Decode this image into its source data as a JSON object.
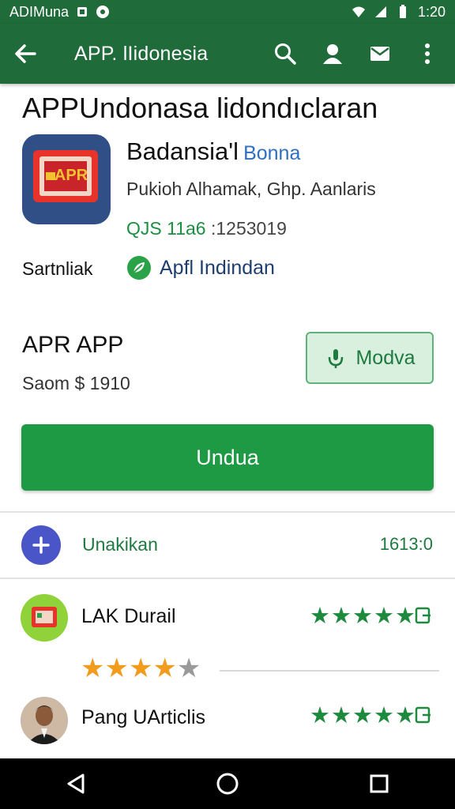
{
  "status_bar": {
    "left_text": "ADIMuna",
    "time": "1:20"
  },
  "app_bar": {
    "title": "APP. lIidonesia"
  },
  "heading": "APPUndonasa lidondıclaran",
  "app": {
    "name": "Badansia'l",
    "tag": "Bonna",
    "subtitle": "Pukioh Alhamak, Ghp. Aanlaris",
    "id_green": "QJS 11a6",
    "id_dark": ":1253019",
    "icon_text": "APR"
  },
  "meta": {
    "label": "Sartnliak",
    "link": "Apfl Indindan"
  },
  "section": {
    "title": "APR APP",
    "subtitle": "Saom $ 1910",
    "modify_button": "Modva"
  },
  "primary_button": "Undua",
  "plus_row": {
    "label": "Unakikan",
    "value": "1613:0"
  },
  "reviews": [
    {
      "name": "LAK Durail"
    },
    {
      "name": "Pang UArticlis"
    }
  ],
  "ratings": {
    "green_row1": "★★★★★",
    "green_row2": "★★★★★",
    "orange_on": "★★★★",
    "orange_off": "★"
  },
  "colors": {
    "primary_green": "#1f9a44",
    "app_bar": "#1f6b3a",
    "accent_blue": "#4a55c8",
    "star_orange": "#f29c1e"
  }
}
